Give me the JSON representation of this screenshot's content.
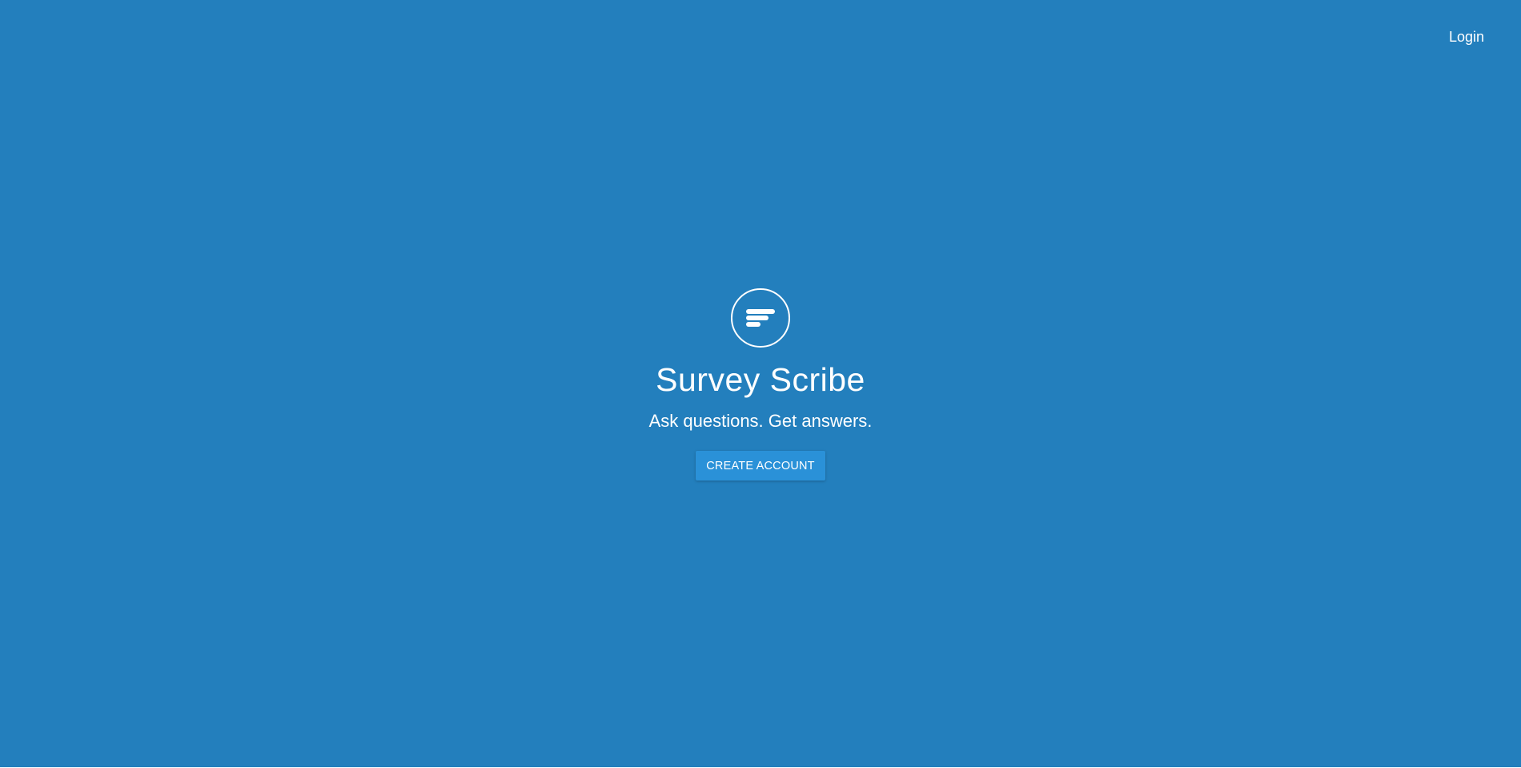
{
  "header": {
    "login_label": "Login"
  },
  "hero": {
    "logo_icon": "survey-lines-icon",
    "title": "Survey Scribe",
    "tagline": "Ask questions. Get answers.",
    "cta_label": "CREATE ACCOUNT"
  },
  "colors": {
    "background": "#237fbd",
    "button": "#2a91d8",
    "text": "#ffffff"
  }
}
